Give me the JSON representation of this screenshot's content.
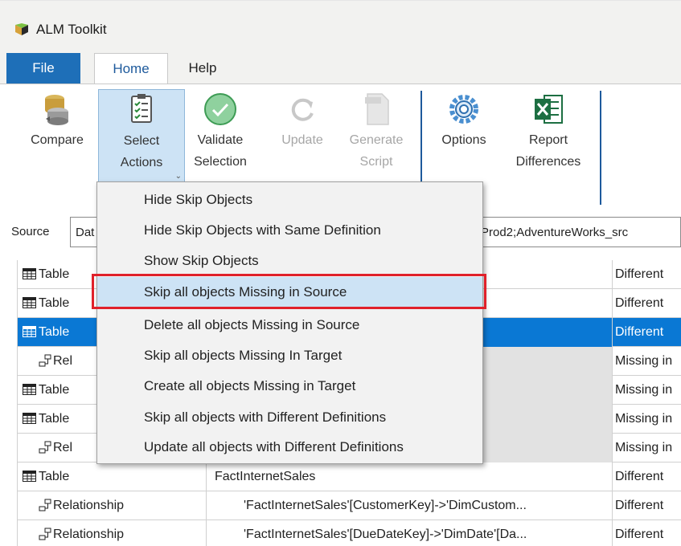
{
  "app": {
    "title": "ALM Toolkit"
  },
  "tabs": [
    {
      "label": "File"
    },
    {
      "label": "Home"
    },
    {
      "label": "Help"
    }
  ],
  "ribbon": {
    "compare": {
      "line1": "Compare",
      "line2": ""
    },
    "select_actions": {
      "line1": "Select",
      "line2": "Actions"
    },
    "validate": {
      "line1": "Validate",
      "line2": "Selection"
    },
    "update": {
      "line1": "Update",
      "line2": ""
    },
    "generate": {
      "line1": "Generate",
      "line2": "Script"
    },
    "options": {
      "line1": "Options",
      "line2": ""
    },
    "report": {
      "line1": "Report",
      "line2": "Differences"
    }
  },
  "source": {
    "label": "Source",
    "value_left": "Dat",
    "value_right": "Prod2;AdventureWorks_src"
  },
  "menu": {
    "items": [
      "Hide Skip Objects",
      "Hide Skip Objects with Same Definition",
      "Show Skip Objects",
      "Skip all objects Missing in Source",
      "Delete all objects Missing in Source",
      "Skip all objects Missing In Target",
      "Create all objects Missing in Target",
      "Skip all objects with Different Definitions",
      "Update all objects with Different Definitions"
    ],
    "highlighted_index": 3
  },
  "grid": {
    "rows": [
      {
        "type": "Table",
        "name": "",
        "status": "Different"
      },
      {
        "type": "Table",
        "name": "",
        "status": "Different"
      },
      {
        "type": "Table",
        "name": "",
        "status": "Different"
      },
      {
        "type": "Rel",
        "name": "",
        "status": "Missing in"
      },
      {
        "type": "Table",
        "name": "",
        "status": "Missing in"
      },
      {
        "type": "Table",
        "name": "",
        "status": "Missing in"
      },
      {
        "type": "Rel",
        "name": "",
        "status": "Missing in"
      },
      {
        "type": "Table",
        "name": "FactInternetSales",
        "status": "Different"
      },
      {
        "type": "Relationship",
        "name": "'FactInternetSales'[CustomerKey]->'DimCustom...",
        "status": "Different"
      },
      {
        "type": "Relationship",
        "name": "'FactInternetSales'[DueDateKey]->'DimDate'[Da...",
        "status": "Different"
      }
    ]
  },
  "colors": {
    "accent": "#1e6fb8",
    "selected_row": "#0a78d4",
    "highlight_box": "#e0212b",
    "menu_hover": "#cde3f5"
  }
}
